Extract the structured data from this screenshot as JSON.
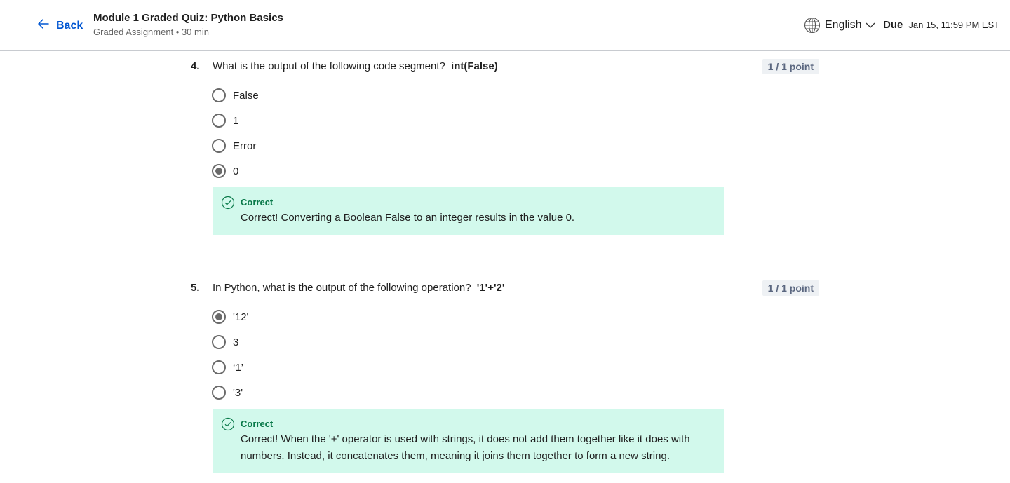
{
  "header": {
    "back_label": "Back",
    "title": "Module 1 Graded Quiz: Python Basics",
    "subtitle": "Graded Assignment • 30 min",
    "language": "English",
    "due_label": "Due",
    "due_date": "Jan 15, 11:59 PM EST"
  },
  "questions": [
    {
      "number": "4.",
      "text": "What is the output of the following code segment?",
      "code": "int(False)",
      "points": "1 / 1 point",
      "options": [
        "False",
        "1",
        "Error",
        "0"
      ],
      "selected_index": 3,
      "feedback_title": "Correct",
      "feedback_text": "Correct! Converting a Boolean False to an integer results in the value 0."
    },
    {
      "number": "5.",
      "text": "In Python, what is the output of the following operation?",
      "code": "'1'+'2'",
      "points": "1 / 1 point",
      "options": [
        "'12'",
        "3",
        "‘1’",
        "'3'"
      ],
      "selected_index": 0,
      "feedback_title": "Correct",
      "feedback_text": "Correct! When the '+' operator is used with strings, it does not add them together like it does with numbers. Instead, it concatenates them, meaning it joins them together to form a new string."
    }
  ],
  "colors": {
    "accent": "#0056d2",
    "correct_bg": "#d2f9ec",
    "correct_text": "#0a7a4a",
    "points_bg": "#eef1f4"
  },
  "icons": {
    "back": "arrow-left-icon",
    "language": "globe-icon",
    "dropdown": "chevron-down-icon",
    "feedback": "check-circle-icon"
  }
}
